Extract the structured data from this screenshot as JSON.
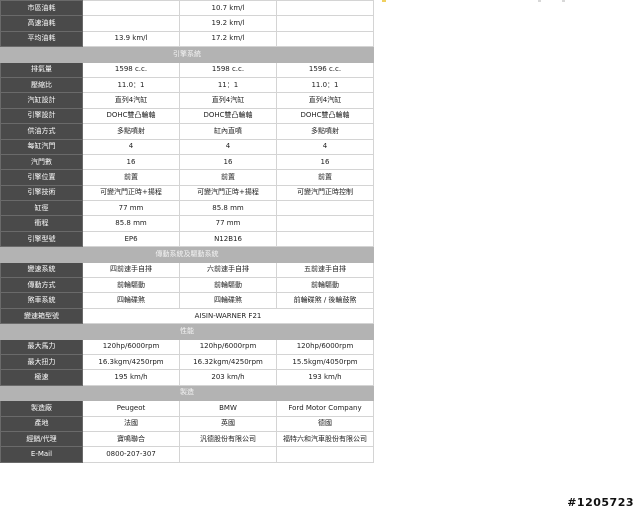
{
  "rows": [
    {
      "type": "row",
      "label": "市區油耗",
      "c1": "",
      "c2": "10.7 km/l",
      "c3": ""
    },
    {
      "type": "row",
      "label": "高速油耗",
      "c1": "",
      "c2": "19.2 km/l",
      "c3": ""
    },
    {
      "type": "row",
      "label": "平均油耗",
      "c1": "13.9 km/l",
      "c2": "17.2 km/l",
      "c3": ""
    },
    {
      "type": "section",
      "title": "引擎系統"
    },
    {
      "type": "row",
      "label": "排氣量",
      "c1": "1598 c.c.",
      "c2": "1598 c.c.",
      "c3": "1596 c.c."
    },
    {
      "type": "row",
      "label": "壓縮比",
      "c1": "11.0：1",
      "c2": "11：1",
      "c3": "11.0：1"
    },
    {
      "type": "row",
      "label": "汽缸設計",
      "c1": "直列4汽缸",
      "c2": "直列4汽缸",
      "c3": "直列4汽缸"
    },
    {
      "type": "row",
      "label": "引擎設計",
      "c1": "DOHC雙凸輪軸",
      "c2": "DOHC雙凸輪軸",
      "c3": "DOHC雙凸輪軸"
    },
    {
      "type": "row",
      "label": "供油方式",
      "c1": "多點噴射",
      "c2": "缸內直噴",
      "c3": "多點噴射"
    },
    {
      "type": "row",
      "label": "每缸汽門",
      "c1": "4",
      "c2": "4",
      "c3": "4"
    },
    {
      "type": "row",
      "label": "汽門數",
      "c1": "16",
      "c2": "16",
      "c3": "16"
    },
    {
      "type": "row",
      "label": "引擎位置",
      "c1": "前置",
      "c2": "前置",
      "c3": "前置"
    },
    {
      "type": "row",
      "label": "引擎技術",
      "c1": "可變汽門正時+揚程",
      "c2": "可變汽門正時+揚程",
      "c3": "可變汽門正時控制"
    },
    {
      "type": "row",
      "label": "缸徑",
      "c1": "77 mm",
      "c2": "85.8 mm",
      "c3": ""
    },
    {
      "type": "row",
      "label": "衝程",
      "c1": "85.8 mm",
      "c2": "77 mm",
      "c3": ""
    },
    {
      "type": "row",
      "label": "引擎型號",
      "c1": "EP6",
      "c2": "N12B16",
      "c3": ""
    },
    {
      "type": "section",
      "title": "傳動系統及驅動系統"
    },
    {
      "type": "row",
      "label": "變速系統",
      "c1": "四前速手自排",
      "c2": "六前速手自排",
      "c3": "五前速手自排"
    },
    {
      "type": "row",
      "label": "傳動方式",
      "c1": "前輪驅動",
      "c2": "前輪驅動",
      "c3": "前輪驅動"
    },
    {
      "type": "row",
      "label": "煞車系統",
      "c1": "四輪碟煞",
      "c2": "四輪碟煞",
      "c3": "前輪碟煞 / 後輪鼓煞"
    },
    {
      "type": "span",
      "label": "變速箱型號",
      "value": "AISIN-WARNER F21"
    },
    {
      "type": "section",
      "title": "性能"
    },
    {
      "type": "row",
      "label": "最大馬力",
      "c1": "120hp/6000rpm",
      "c2": "120hp/6000rpm",
      "c3": "120hp/6000rpm"
    },
    {
      "type": "row",
      "label": "最大扭力",
      "c1": "16.3kgm/4250rpm",
      "c2": "16.32kgm/4250rpm",
      "c3": "15.5kgm/4050rpm"
    },
    {
      "type": "row",
      "label": "極速",
      "c1": "195 km/h",
      "c2": "203 km/h",
      "c3": "193 km/h"
    },
    {
      "type": "section",
      "title": "製造"
    },
    {
      "type": "row",
      "label": "製造廠",
      "c1": "Peugeot",
      "c2": "BMW",
      "c3": "Ford Motor Company"
    },
    {
      "type": "row",
      "label": "產地",
      "c1": "法國",
      "c2": "英國",
      "c3": "德國"
    },
    {
      "type": "row",
      "label": "經銷/代理",
      "c1": "寶鳴聯合",
      "c2": "汎德股份有限公司",
      "c3": "福特六和汽車股份有限公司"
    },
    {
      "type": "row",
      "label": "E-Mail",
      "c1": "0800-207-307",
      "c2": "",
      "c3": ""
    }
  ],
  "watermark": "#1205723",
  "colors": {
    "label_bg": "#4a4a4a",
    "section_bg": "#b3b3b3",
    "cell_border": "#d4d4d4"
  }
}
